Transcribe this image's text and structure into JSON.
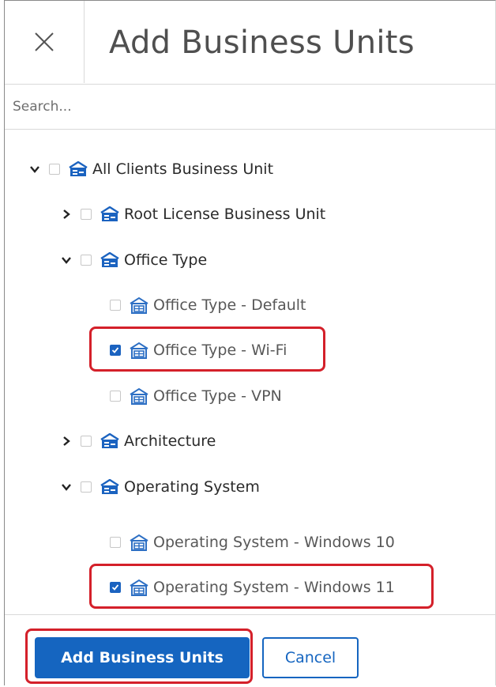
{
  "dialog": {
    "title": "Add Business Units",
    "close_icon": "close-icon"
  },
  "search": {
    "placeholder": "Search...",
    "value": ""
  },
  "tree": {
    "nodes": [
      {
        "label": "All Clients Business Unit",
        "expanded": true,
        "checked": false,
        "icon": "business-unit-icon"
      },
      {
        "label": "Root License Business Unit",
        "expanded": false,
        "checked": false,
        "icon": "business-unit-icon"
      },
      {
        "label": "Office Type",
        "expanded": true,
        "checked": false,
        "icon": "business-unit-icon"
      },
      {
        "label": "Office Type - Default",
        "checked": false,
        "icon": "building-icon"
      },
      {
        "label": "Office Type - Wi-Fi",
        "checked": true,
        "icon": "building-icon"
      },
      {
        "label": "Office Type - VPN",
        "checked": false,
        "icon": "building-icon"
      },
      {
        "label": "Architecture",
        "expanded": false,
        "checked": false,
        "icon": "business-unit-icon"
      },
      {
        "label": "Operating System",
        "expanded": true,
        "checked": false,
        "icon": "business-unit-icon"
      },
      {
        "label": "Operating System - Windows 10",
        "checked": false,
        "icon": "building-icon"
      },
      {
        "label": "Operating System - Windows 11",
        "checked": true,
        "icon": "building-icon"
      }
    ]
  },
  "footer": {
    "primary_label": "Add Business Units",
    "secondary_label": "Cancel"
  },
  "colors": {
    "primary": "#1565c0",
    "checked": "#1b63c0",
    "highlight": "#d4202a",
    "parent_icon": "#1b63c0",
    "leaf_icon": "#2d6fc4"
  }
}
